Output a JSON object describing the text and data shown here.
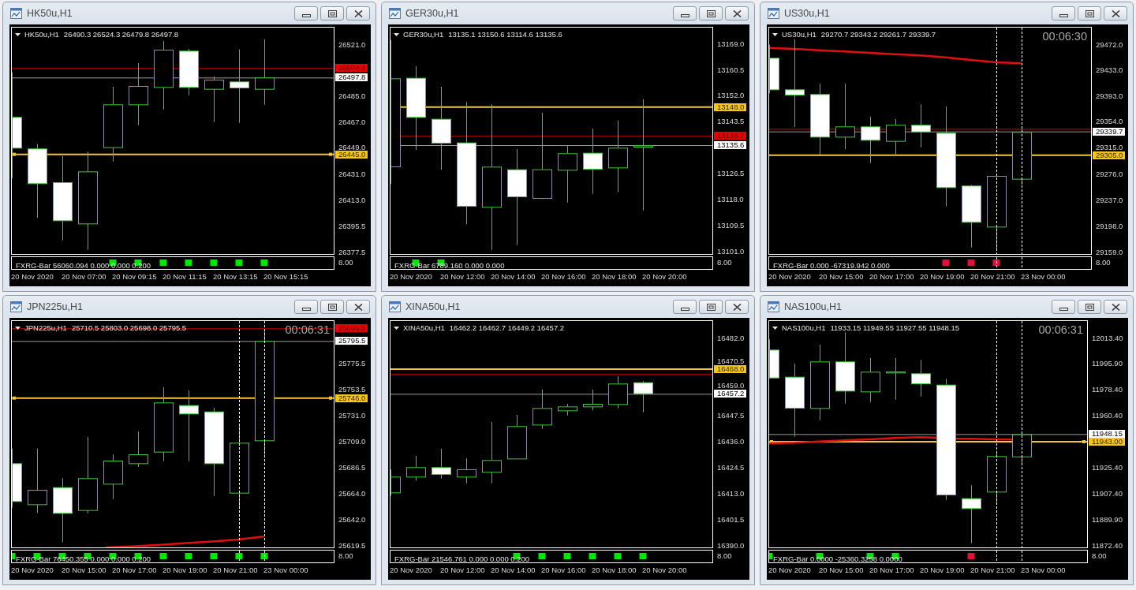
{
  "windows": [
    {
      "title": "HK50u,H1",
      "header": {
        "symbol": "HK50u,H1",
        "ohlc": "26490.3 26524.3 26479.8 26497.8"
      },
      "price_scale": [
        "26521.0",
        "26485.0",
        "26467.0",
        "26449.0",
        "26431.0",
        "26413.0",
        "26395.5",
        "26377.5"
      ],
      "ask_price": "26504.4",
      "bid_price": "26497.8",
      "horizontal_line": {
        "price": "26445.0",
        "selected": true
      },
      "indicator": {
        "values": "FXRG-Bar 56060.094 0.000 0.000 0.200",
        "scale": "8.00",
        "signals": [
          {
            "color": "#00e600"
          },
          {
            "color": "#00e600"
          },
          {
            "color": "#00e600"
          },
          {
            "color": "#00e600"
          },
          {
            "color": "#00e600"
          },
          {
            "color": "#00e600"
          },
          {
            "color": "#00e600"
          }
        ]
      },
      "time_axis": [
        "20 Nov 2020",
        "20 Nov 07:00",
        "20 Nov 09:15",
        "20 Nov 11:15",
        "20 Nov 13:15",
        "20 Nov 15:15"
      ]
    },
    {
      "title": "GER30u,H1",
      "header": {
        "symbol": "GER30u,H1",
        "ohlc": "13135.1 13150.6 13114.6 13135.6"
      },
      "price_scale": [
        "13169.0",
        "13160.5",
        "13152.0",
        "13143.5",
        "13126.5",
        "13118.0",
        "13109.5",
        "13101.0"
      ],
      "ask_price": "13138.7",
      "bid_price": "13135.6",
      "horizontal_line": {
        "price": "13148.0",
        "selected": false
      },
      "indicator": {
        "values": "FXRG-Bar 6789.160 0.000 0.000",
        "scale": "8.00",
        "signals": [
          {
            "color": "#00e600"
          },
          {
            "color": "#00e600"
          }
        ]
      },
      "time_axis": [
        "20 Nov 2020",
        "20 Nov 12:00",
        "20 Nov 14:00",
        "20 Nov 16:00",
        "20 Nov 18:00",
        "20 Nov 20:00"
      ]
    },
    {
      "title": "US30u,H1",
      "header": {
        "symbol": "US30u,H1",
        "ohlc": "29270.7 29343.2 29261.7 29339.7"
      },
      "countdown": "00:06:30",
      "price_scale": [
        "29472.0",
        "29433.0",
        "29393.0",
        "29354.0",
        "29315.0",
        "29276.0",
        "29237.0",
        "29198.0",
        "29159.0"
      ],
      "bid_price": "29339.7",
      "horizontal_line": {
        "price": "29305.0",
        "selected": false
      },
      "indicator": {
        "values": "FXRG-Bar 0.000 -67319.942 0.000",
        "scale": "8.00",
        "signals": [
          {
            "color": "#dc143c"
          },
          {
            "color": "#dc143c"
          },
          {
            "color": "#dc143c"
          }
        ]
      },
      "time_axis": [
        "20 Nov 2020",
        "20 Nov 15:00",
        "20 Nov 17:00",
        "20 Nov 19:00",
        "20 Nov 21:00",
        "23 Nov 00:00"
      ]
    },
    {
      "title": "JPN225u,H1",
      "header": {
        "symbol": "JPN225u,H1",
        "ohlc": "25710.5 25803.0 25698.0 25795.5"
      },
      "countdown": "00:06:31",
      "price_scale": [
        "25775.5",
        "25753.5",
        "25731.0",
        "25709.0",
        "25686.5",
        "25664.0",
        "25642.0",
        "25619.5"
      ],
      "ask_price": "25806.5",
      "bid_price": "25795.5",
      "horizontal_line": {
        "price": "25746.0",
        "selected": true
      },
      "indicator": {
        "values": "FXRG-Bar 76450.355 0.000 0.000 0.200",
        "scale": "8.00",
        "signals": [
          {
            "color": "#00e600"
          },
          {
            "color": "#00e600"
          },
          {
            "color": "#00e600"
          },
          {
            "color": "#00e600"
          },
          {
            "color": "#00e600"
          },
          {
            "color": "#00e600"
          },
          {
            "color": "#00e600"
          },
          {
            "color": "#00e600"
          },
          {
            "color": "#00e600"
          },
          {
            "color": "#00e600"
          },
          {
            "color": "#00e600"
          }
        ]
      },
      "time_axis": [
        "20 Nov 2020",
        "20 Nov 15:00",
        "20 Nov 17:00",
        "20 Nov 19:00",
        "20 Nov 21:00",
        "23 Nov 00:00"
      ]
    },
    {
      "title": "XINA50u,H1",
      "header": {
        "symbol": "XINA50u,H1",
        "ohlc": "16462.2 16462.7 16449.2 16457.2"
      },
      "price_scale": [
        "16482.0",
        "16470.5",
        "16459.0",
        "16447.5",
        "16436.0",
        "16424.5",
        "16413.0",
        "16401.5",
        "16390.0"
      ],
      "bid_price": "16457.2",
      "horizontal_line": {
        "price": "16468.0",
        "selected": false
      },
      "indicator": {
        "values": "FXRG-Bar 21546.761 0.000 0.000 0.200",
        "scale": "8.00",
        "signals": [
          {
            "color": "#00e600"
          },
          {
            "color": "#00e600"
          },
          {
            "color": "#00e600"
          },
          {
            "color": "#00e600"
          },
          {
            "color": "#00e600"
          },
          {
            "color": "#00e600"
          }
        ]
      },
      "time_axis": [
        "20 Nov 2020",
        "20 Nov 12:00",
        "20 Nov 14:00",
        "20 Nov 16:00",
        "20 Nov 18:00",
        "20 Nov 20:00"
      ]
    },
    {
      "title": "NAS100u,H1",
      "header": {
        "symbol": "NAS100u,H1",
        "ohlc": "11933.15 11949.55 11927.55 11948.15"
      },
      "countdown": "00:06:31",
      "price_scale": [
        "12013.40",
        "11995.90",
        "11978.40",
        "11960.40",
        "11925.40",
        "11907.40",
        "11889.90",
        "11872.40"
      ],
      "bid_price": "11948.15",
      "horizontal_line": {
        "price": "11943.00",
        "selected": true
      },
      "indicator": {
        "values": "FXRG-Bar 0.0000 -25360.3258 0.0000",
        "scale": "8.00",
        "signals": [
          {
            "color": "#00e600"
          },
          {
            "color": "#00e600"
          },
          {
            "color": "#00e600"
          },
          {
            "color": "#00e600"
          },
          {
            "color": "#dc143c"
          }
        ]
      },
      "time_axis": [
        "20 Nov 2020",
        "20 Nov 15:00",
        "20 Nov 17:00",
        "20 Nov 19:00",
        "20 Nov 21:00",
        "23 Nov 00:00"
      ]
    }
  ]
}
